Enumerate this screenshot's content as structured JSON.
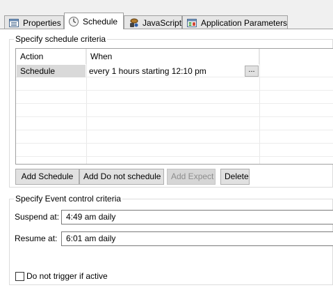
{
  "tabs": [
    {
      "label": "Properties",
      "icon": "properties-icon",
      "active": false
    },
    {
      "label": "Schedule",
      "icon": "clock-icon",
      "active": true
    },
    {
      "label": "JavaScript",
      "icon": "javascript-icon",
      "active": false
    },
    {
      "label": "Application Parameters",
      "icon": "parameters-icon",
      "active": false
    }
  ],
  "schedule_criteria": {
    "title": "Specify schedule criteria",
    "columns": [
      "Action",
      "When"
    ],
    "rows": [
      {
        "action": "Schedule",
        "when": "every 1 hours starting 12:10 pm"
      }
    ],
    "row_button_label": "...",
    "buttons": {
      "add_schedule": "Add Schedule",
      "add_do_not_schedule": "Add Do not schedule",
      "add_expect": "Add Expect",
      "delete": "Delete"
    }
  },
  "event_criteria": {
    "title": "Specify Event control criteria",
    "suspend_label": "Suspend at:",
    "suspend_value": "4:49 am daily",
    "resume_label": "Resume at:",
    "resume_value": "6:01 am daily",
    "checkbox_label": "Do not trigger if active",
    "checkbox_checked": false
  },
  "colors": {
    "selected_row": "#d9d9d9",
    "disabled_text": "#8d8d8d"
  }
}
